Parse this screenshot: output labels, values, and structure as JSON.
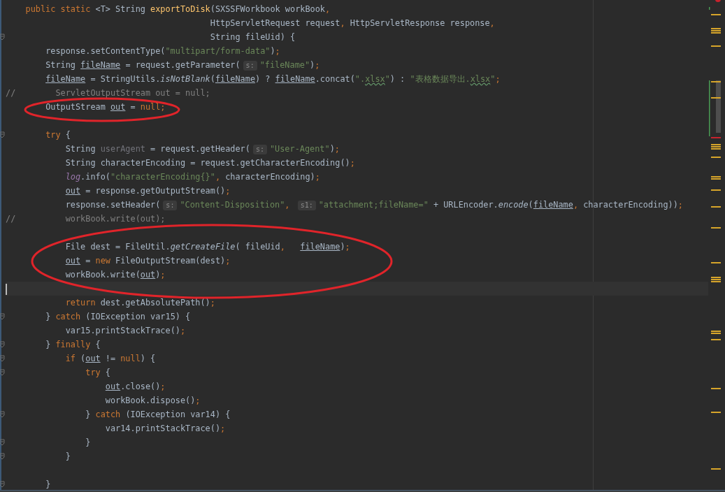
{
  "editor": {
    "lines": [
      {
        "fold": false,
        "current": false,
        "tokens": [
          {
            "kind": "keyword",
            "text": "    public static "
          },
          {
            "kind": "plain",
            "text": "<T> String "
          },
          {
            "kind": "declaration",
            "text": "exportToDisk"
          },
          {
            "kind": "plain",
            "text": "(SXSSFWorkbook workBook"
          },
          {
            "kind": "punct",
            "text": ","
          }
        ]
      },
      {
        "fold": false,
        "current": false,
        "tokens": [
          {
            "kind": "plain",
            "text": "                                         HttpServletRequest request"
          },
          {
            "kind": "punct",
            "text": ", "
          },
          {
            "kind": "plain",
            "text": "HttpServletResponse response"
          },
          {
            "kind": "punct",
            "text": ","
          }
        ]
      },
      {
        "fold": true,
        "current": false,
        "tokens": [
          {
            "kind": "plain",
            "text": "                                         String fileUid) {"
          }
        ]
      },
      {
        "fold": false,
        "current": false,
        "tokens": [
          {
            "kind": "plain",
            "text": "        response.setContentType("
          },
          {
            "kind": "string",
            "text": "\"multipart/form-data\""
          },
          {
            "kind": "plain",
            "text": ")"
          },
          {
            "kind": "punct",
            "text": ";"
          }
        ]
      },
      {
        "fold": false,
        "current": false,
        "tokens": [
          {
            "kind": "plain",
            "text": "        String "
          },
          {
            "kind": "underlined",
            "text": "fileName"
          },
          {
            "kind": "plain",
            "text": " = request.getParameter("
          },
          {
            "kind": "hint",
            "text": "s:"
          },
          {
            "kind": "string",
            "text": "\"fileName\""
          },
          {
            "kind": "plain",
            "text": ")"
          },
          {
            "kind": "punct",
            "text": ";"
          }
        ]
      },
      {
        "fold": false,
        "current": false,
        "tokens": [
          {
            "kind": "underlined",
            "text": "        fileName"
          },
          {
            "kind": "plain",
            "text": " = StringUtils."
          },
          {
            "kind": "italic",
            "text": "isNotBlank"
          },
          {
            "kind": "plain",
            "text": "("
          },
          {
            "kind": "underlined",
            "text": "fileName"
          },
          {
            "kind": "plain",
            "text": ") ? "
          },
          {
            "kind": "underlined",
            "text": "fileName"
          },
          {
            "kind": "plain",
            "text": ".concat("
          },
          {
            "kind": "string",
            "text": "\"."
          },
          {
            "kind": "typo",
            "text": "xlsx"
          },
          {
            "kind": "string",
            "text": "\""
          },
          {
            "kind": "plain",
            "text": ") : "
          },
          {
            "kind": "string",
            "text": "\"表格数据导出."
          },
          {
            "kind": "typo",
            "text": "xlsx"
          },
          {
            "kind": "string",
            "text": "\""
          },
          {
            "kind": "punct",
            "text": ";"
          }
        ]
      },
      {
        "fold": false,
        "current": false,
        "tokens": [
          {
            "kind": "comment",
            "text": "//        ServletOutputStream out = null;"
          }
        ]
      },
      {
        "fold": false,
        "current": false,
        "tokens": [
          {
            "kind": "plain",
            "text": "        OutputStream "
          },
          {
            "kind": "underlined",
            "text": "out"
          },
          {
            "kind": "plain",
            "text": " = "
          },
          {
            "kind": "keyword",
            "text": "null"
          },
          {
            "kind": "punct",
            "text": ";"
          }
        ]
      },
      {
        "fold": false,
        "current": false
      },
      {
        "fold": true,
        "current": false,
        "tokens": [
          {
            "kind": "keyword",
            "text": "        try "
          },
          {
            "kind": "plain",
            "text": "{"
          }
        ]
      },
      {
        "fold": false,
        "current": false,
        "tokens": [
          {
            "kind": "plain",
            "text": "            String "
          },
          {
            "kind": "unused",
            "text": "userAgent"
          },
          {
            "kind": "plain",
            "text": " = request.getHeader("
          },
          {
            "kind": "hint",
            "text": "s:"
          },
          {
            "kind": "string",
            "text": "\"User-Agent\""
          },
          {
            "kind": "plain",
            "text": ")"
          },
          {
            "kind": "punct",
            "text": ";"
          }
        ]
      },
      {
        "fold": false,
        "current": false,
        "tokens": [
          {
            "kind": "plain",
            "text": "            String characterEncoding = request.getCharacterEncoding()"
          },
          {
            "kind": "punct",
            "text": ";"
          }
        ]
      },
      {
        "fold": false,
        "current": false,
        "tokens": [
          {
            "kind": "field",
            "text": "            log"
          },
          {
            "kind": "plain",
            "text": ".info("
          },
          {
            "kind": "string",
            "text": "\"characterEncoding{}\""
          },
          {
            "kind": "punct",
            "text": ", "
          },
          {
            "kind": "plain",
            "text": "characterEncoding)"
          },
          {
            "kind": "punct",
            "text": ";"
          }
        ]
      },
      {
        "fold": false,
        "current": false,
        "tokens": [
          {
            "kind": "underlined",
            "text": "            out"
          },
          {
            "kind": "plain",
            "text": " = response.getOutputStream()"
          },
          {
            "kind": "punct",
            "text": ";"
          }
        ]
      },
      {
        "fold": false,
        "current": false,
        "tokens": [
          {
            "kind": "plain",
            "text": "            response.setHeader("
          },
          {
            "kind": "hint",
            "text": "s:"
          },
          {
            "kind": "string",
            "text": "\"Content-Disposition\""
          },
          {
            "kind": "punct",
            "text": ", "
          },
          {
            "kind": "hint",
            "text": "s1:"
          },
          {
            "kind": "string",
            "text": "\"attachment;fileName=\""
          },
          {
            "kind": "plain",
            "text": " + URLEncoder."
          },
          {
            "kind": "italic",
            "text": "encode"
          },
          {
            "kind": "plain",
            "text": "("
          },
          {
            "kind": "underlined",
            "text": "fileName"
          },
          {
            "kind": "punct",
            "text": ", "
          },
          {
            "kind": "plain",
            "text": "characterEncoding))"
          },
          {
            "kind": "punct",
            "text": ";"
          }
        ]
      },
      {
        "fold": false,
        "current": false,
        "tokens": [
          {
            "kind": "comment",
            "text": "//          workBook.write(out);"
          }
        ]
      },
      {
        "fold": false,
        "current": false
      },
      {
        "fold": false,
        "current": false,
        "tokens": [
          {
            "kind": "plain",
            "text": "            File dest = FileUtil."
          },
          {
            "kind": "italic",
            "text": "getCreateFile"
          },
          {
            "kind": "plain",
            "text": "( fileUid"
          },
          {
            "kind": "punct",
            "text": ",   "
          },
          {
            "kind": "underlined",
            "text": "fileName"
          },
          {
            "kind": "plain",
            "text": ")"
          },
          {
            "kind": "punct",
            "text": ";"
          }
        ]
      },
      {
        "fold": false,
        "current": false,
        "tokens": [
          {
            "kind": "underlined",
            "text": "            out"
          },
          {
            "kind": "plain",
            "text": " = "
          },
          {
            "kind": "keyword",
            "text": "new "
          },
          {
            "kind": "plain",
            "text": "FileOutputStream(dest)"
          },
          {
            "kind": "punct",
            "text": ";"
          }
        ]
      },
      {
        "fold": false,
        "current": false,
        "tokens": [
          {
            "kind": "plain",
            "text": "            workBook.write("
          },
          {
            "kind": "underlined",
            "text": "out"
          },
          {
            "kind": "plain",
            "text": ")"
          },
          {
            "kind": "punct",
            "text": ";"
          }
        ]
      },
      {
        "fold": false,
        "current": true
      },
      {
        "fold": false,
        "current": false,
        "tokens": [
          {
            "kind": "keyword",
            "text": "            return "
          },
          {
            "kind": "plain",
            "text": "dest.getAbsolutePath()"
          },
          {
            "kind": "punct",
            "text": ";"
          }
        ]
      },
      {
        "fold": true,
        "current": false,
        "tokens": [
          {
            "kind": "plain",
            "text": "        } "
          },
          {
            "kind": "keyword",
            "text": "catch "
          },
          {
            "kind": "plain",
            "text": "(IOException var15) {"
          }
        ]
      },
      {
        "fold": false,
        "current": false,
        "tokens": [
          {
            "kind": "plain",
            "text": "            var15.printStackTrace()"
          },
          {
            "kind": "punct",
            "text": ";"
          }
        ]
      },
      {
        "fold": true,
        "current": false,
        "tokens": [
          {
            "kind": "plain",
            "text": "        } "
          },
          {
            "kind": "keyword",
            "text": "finally "
          },
          {
            "kind": "plain",
            "text": "{"
          }
        ]
      },
      {
        "fold": true,
        "current": false,
        "tokens": [
          {
            "kind": "keyword",
            "text": "            if "
          },
          {
            "kind": "plain",
            "text": "("
          },
          {
            "kind": "underlined",
            "text": "out"
          },
          {
            "kind": "plain",
            "text": " != "
          },
          {
            "kind": "keyword",
            "text": "null"
          },
          {
            "kind": "plain",
            "text": ") {"
          }
        ]
      },
      {
        "fold": true,
        "current": false,
        "tokens": [
          {
            "kind": "keyword",
            "text": "                try "
          },
          {
            "kind": "plain",
            "text": "{"
          }
        ]
      },
      {
        "fold": false,
        "current": false,
        "tokens": [
          {
            "kind": "underlined",
            "text": "                    out"
          },
          {
            "kind": "plain",
            "text": ".close()"
          },
          {
            "kind": "punct",
            "text": ";"
          }
        ]
      },
      {
        "fold": false,
        "current": false,
        "tokens": [
          {
            "kind": "plain",
            "text": "                    workBook.dispose()"
          },
          {
            "kind": "punct",
            "text": ";"
          }
        ]
      },
      {
        "fold": true,
        "current": false,
        "tokens": [
          {
            "kind": "plain",
            "text": "                } "
          },
          {
            "kind": "keyword",
            "text": "catch "
          },
          {
            "kind": "plain",
            "text": "(IOException var14) {"
          }
        ]
      },
      {
        "fold": false,
        "current": false,
        "tokens": [
          {
            "kind": "plain",
            "text": "                    var14.printStackTrace()"
          },
          {
            "kind": "punct",
            "text": ";"
          }
        ]
      },
      {
        "fold": true,
        "current": false,
        "tokens": [
          {
            "kind": "plain",
            "text": "                }"
          }
        ]
      },
      {
        "fold": true,
        "current": false,
        "tokens": [
          {
            "kind": "plain",
            "text": "            }"
          }
        ]
      },
      {
        "fold": false,
        "current": false
      },
      {
        "fold": true,
        "current": false,
        "tokens": [
          {
            "kind": "plain",
            "text": "        }"
          }
        ]
      }
    ]
  }
}
